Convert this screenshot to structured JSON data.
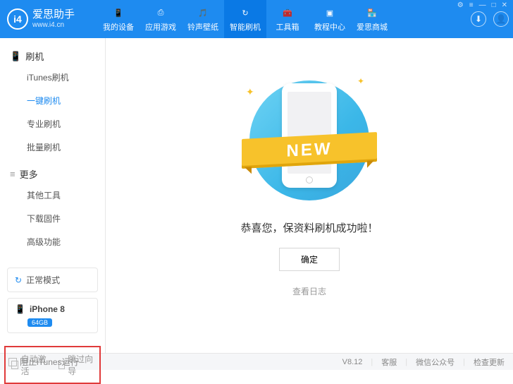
{
  "app": {
    "name": "爱思助手",
    "url": "www.i4.cn",
    "logo_text": "i4"
  },
  "window_controls": {
    "cart": "⚙",
    "grid": "≡",
    "min": "—",
    "max": "□",
    "close": "✕"
  },
  "top_tabs": [
    {
      "label": "我的设备",
      "icon": "📱"
    },
    {
      "label": "应用游戏",
      "icon": "⎙"
    },
    {
      "label": "铃声壁纸",
      "icon": "🎵"
    },
    {
      "label": "智能刷机",
      "icon": "↻",
      "active": true
    },
    {
      "label": "工具箱",
      "icon": "🧰"
    },
    {
      "label": "教程中心",
      "icon": "▣"
    },
    {
      "label": "爱思商城",
      "icon": "🏪"
    }
  ],
  "header_icons": {
    "download": "⬇",
    "user": "👤"
  },
  "sidebar": {
    "group1": {
      "title": "刷机",
      "icon": "📱"
    },
    "items1": [
      {
        "label": "iTunes刷机"
      },
      {
        "label": "一键刷机",
        "active": true
      },
      {
        "label": "专业刷机"
      },
      {
        "label": "批量刷机"
      }
    ],
    "group2": {
      "title": "更多",
      "icon": "≡"
    },
    "items2": [
      {
        "label": "其他工具"
      },
      {
        "label": "下载固件"
      },
      {
        "label": "高级功能"
      }
    ],
    "mode": {
      "label": "正常模式",
      "icon": "↻"
    },
    "device": {
      "name": "iPhone 8",
      "storage": "64GB",
      "icon": "📱"
    },
    "options": {
      "auto_activate": "自动激活",
      "skip_wizard": "跳过向导"
    }
  },
  "main": {
    "ribbon": "NEW",
    "success_text": "恭喜您，保资料刷机成功啦！",
    "ok_button": "确定",
    "view_log": "查看日志"
  },
  "footer": {
    "block_itunes": "阻止iTunes运行",
    "version": "V8.12",
    "support": "客服",
    "wechat": "微信公众号",
    "update": "检查更新"
  }
}
